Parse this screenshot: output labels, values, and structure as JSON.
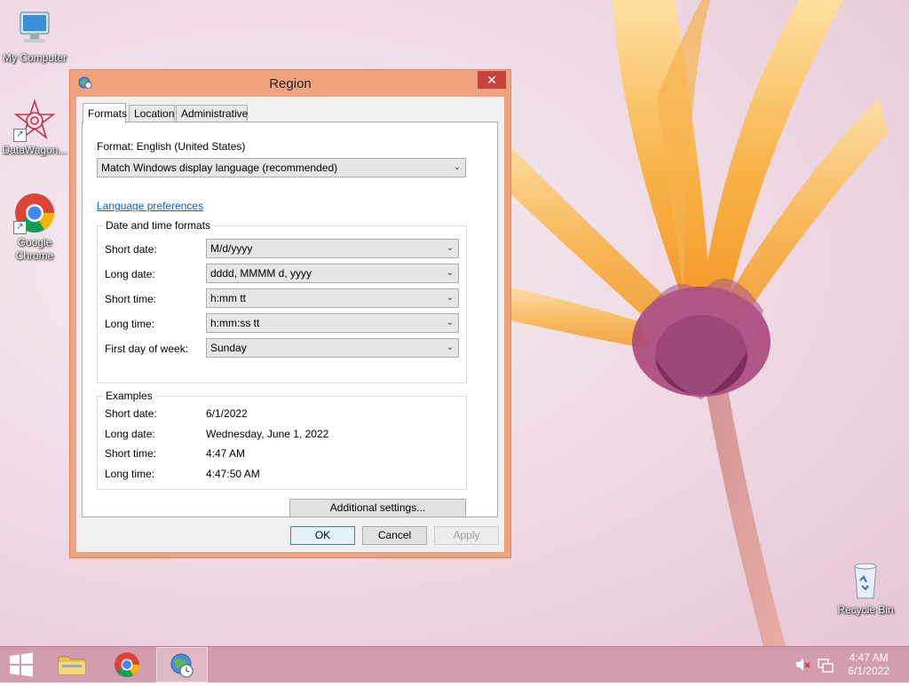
{
  "desktop": {
    "icons": [
      {
        "label": "My Computer"
      },
      {
        "label": "DataWagon..."
      },
      {
        "label": "Google Chrome"
      },
      {
        "label": "Recycle Bin"
      }
    ]
  },
  "dialog": {
    "title": "Region",
    "close_glyph": "✕",
    "tabs": [
      {
        "label": "Formats",
        "active": true
      },
      {
        "label": "Location",
        "active": false
      },
      {
        "label": "Administrative",
        "active": false
      }
    ],
    "format_label": "Format: English (United States)",
    "format_value": "Match Windows display language (recommended)",
    "language_link": "Language preferences",
    "date_time_group": {
      "title": "Date and time formats",
      "rows": [
        {
          "label": "Short date:",
          "value": "M/d/yyyy"
        },
        {
          "label": "Long date:",
          "value": "dddd, MMMM d, yyyy"
        },
        {
          "label": "Short time:",
          "value": "h:mm tt"
        },
        {
          "label": "Long time:",
          "value": "h:mm:ss tt"
        },
        {
          "label": "First day of week:",
          "value": "Sunday"
        }
      ]
    },
    "examples_group": {
      "title": "Examples",
      "rows": [
        {
          "label": "Short date:",
          "value": "6/1/2022"
        },
        {
          "label": "Long date:",
          "value": "Wednesday, June 1, 2022"
        },
        {
          "label": "Short time:",
          "value": "4:47 AM"
        },
        {
          "label": "Long time:",
          "value": "4:47:50 AM"
        }
      ]
    },
    "additional_settings": "Additional settings...",
    "ok": "OK",
    "cancel": "Cancel",
    "apply": "Apply"
  },
  "taskbar": {
    "clock_time": "4:47 AM",
    "clock_date": "6/1/2022"
  },
  "colors": {
    "accent": "#f0a37c",
    "close": "#c7433d",
    "link": "#0066cc"
  }
}
